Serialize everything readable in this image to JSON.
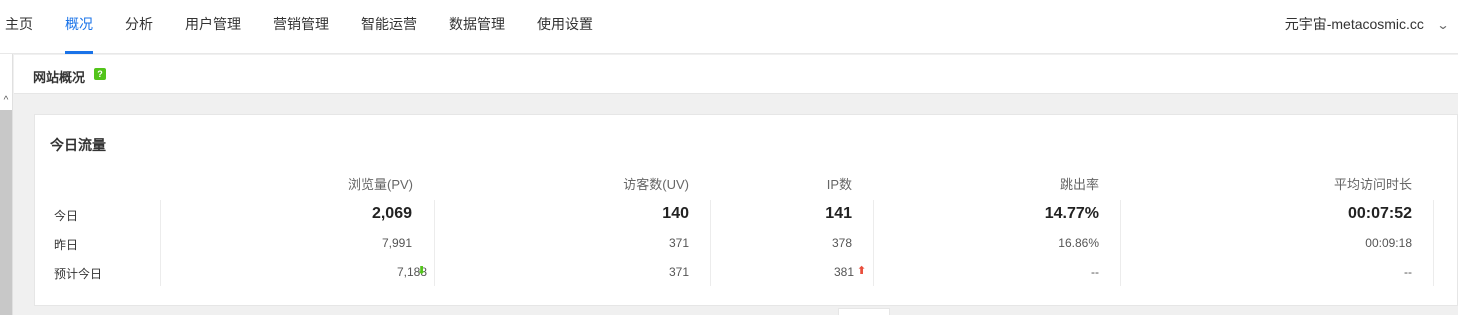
{
  "nav": {
    "items": [
      {
        "label": "主页",
        "active": false
      },
      {
        "label": "概况",
        "active": true
      },
      {
        "label": "分析",
        "active": false
      },
      {
        "label": "用户管理",
        "active": false
      },
      {
        "label": "营销管理",
        "active": false
      },
      {
        "label": "智能运营",
        "active": false
      },
      {
        "label": "数据管理",
        "active": false
      },
      {
        "label": "使用设置",
        "active": false
      }
    ],
    "site": "元宇宙-metacosmic.cc",
    "accent_color": "#1a73e8"
  },
  "subheader": {
    "title": "网站概况",
    "help_icon": "question-icon",
    "help_glyph": "?"
  },
  "traffic": {
    "title": "今日流量",
    "columns": [
      "浏览量(PV)",
      "访客数(UV)",
      "IP数",
      "跳出率",
      "平均访问时长"
    ],
    "rows": [
      {
        "label": "今日",
        "values": [
          "2,069",
          "140",
          "141",
          "14.77%",
          "00:07:52"
        ]
      },
      {
        "label": "昨日",
        "values": [
          "7,991",
          "371",
          "378",
          "16.86%",
          "00:09:18"
        ]
      },
      {
        "label": "预计今日",
        "values": [
          "7,188",
          "371",
          "381",
          "--",
          "--"
        ]
      }
    ],
    "trend_down_icon": "arrow-down-icon",
    "trend_up_icon": "arrow-up-icon",
    "trend_down_glyph": "⬇",
    "trend_up_glyph": "⬆",
    "down_color": "#52c41a",
    "up_color": "#e94e3c"
  }
}
